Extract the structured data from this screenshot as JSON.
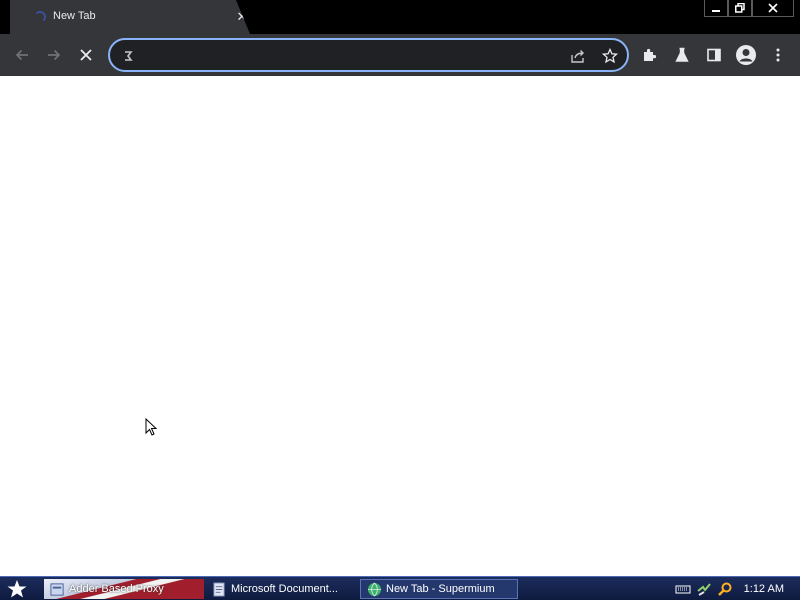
{
  "browser": {
    "tab": {
      "title": "New Tab",
      "close": "✕"
    },
    "window_controls": [
      "minimize",
      "restore",
      "close"
    ],
    "toolbar": {
      "back": "arrow-left-icon",
      "forward": "arrow-right-icon",
      "stop": "close-icon",
      "omnibox_value": "",
      "omnibox_icons": [
        "share-icon",
        "star-icon"
      ],
      "right_icons": [
        "puzzle-icon",
        "flask-icon",
        "side-panel-icon",
        "profile-icon",
        "more-vert-icon"
      ]
    },
    "colors": {
      "frame": "#000000",
      "toolbar": "#35363a",
      "omnibox": "#202124",
      "focus_ring": "#8ab4f8",
      "content": "#ffffff"
    }
  },
  "taskbar": {
    "tasks": [
      {
        "label": "Adder Based Proxy"
      },
      {
        "label": "Microsoft Document..."
      },
      {
        "label": "New Tab - Supermium"
      }
    ],
    "clock": "1:12 AM"
  }
}
